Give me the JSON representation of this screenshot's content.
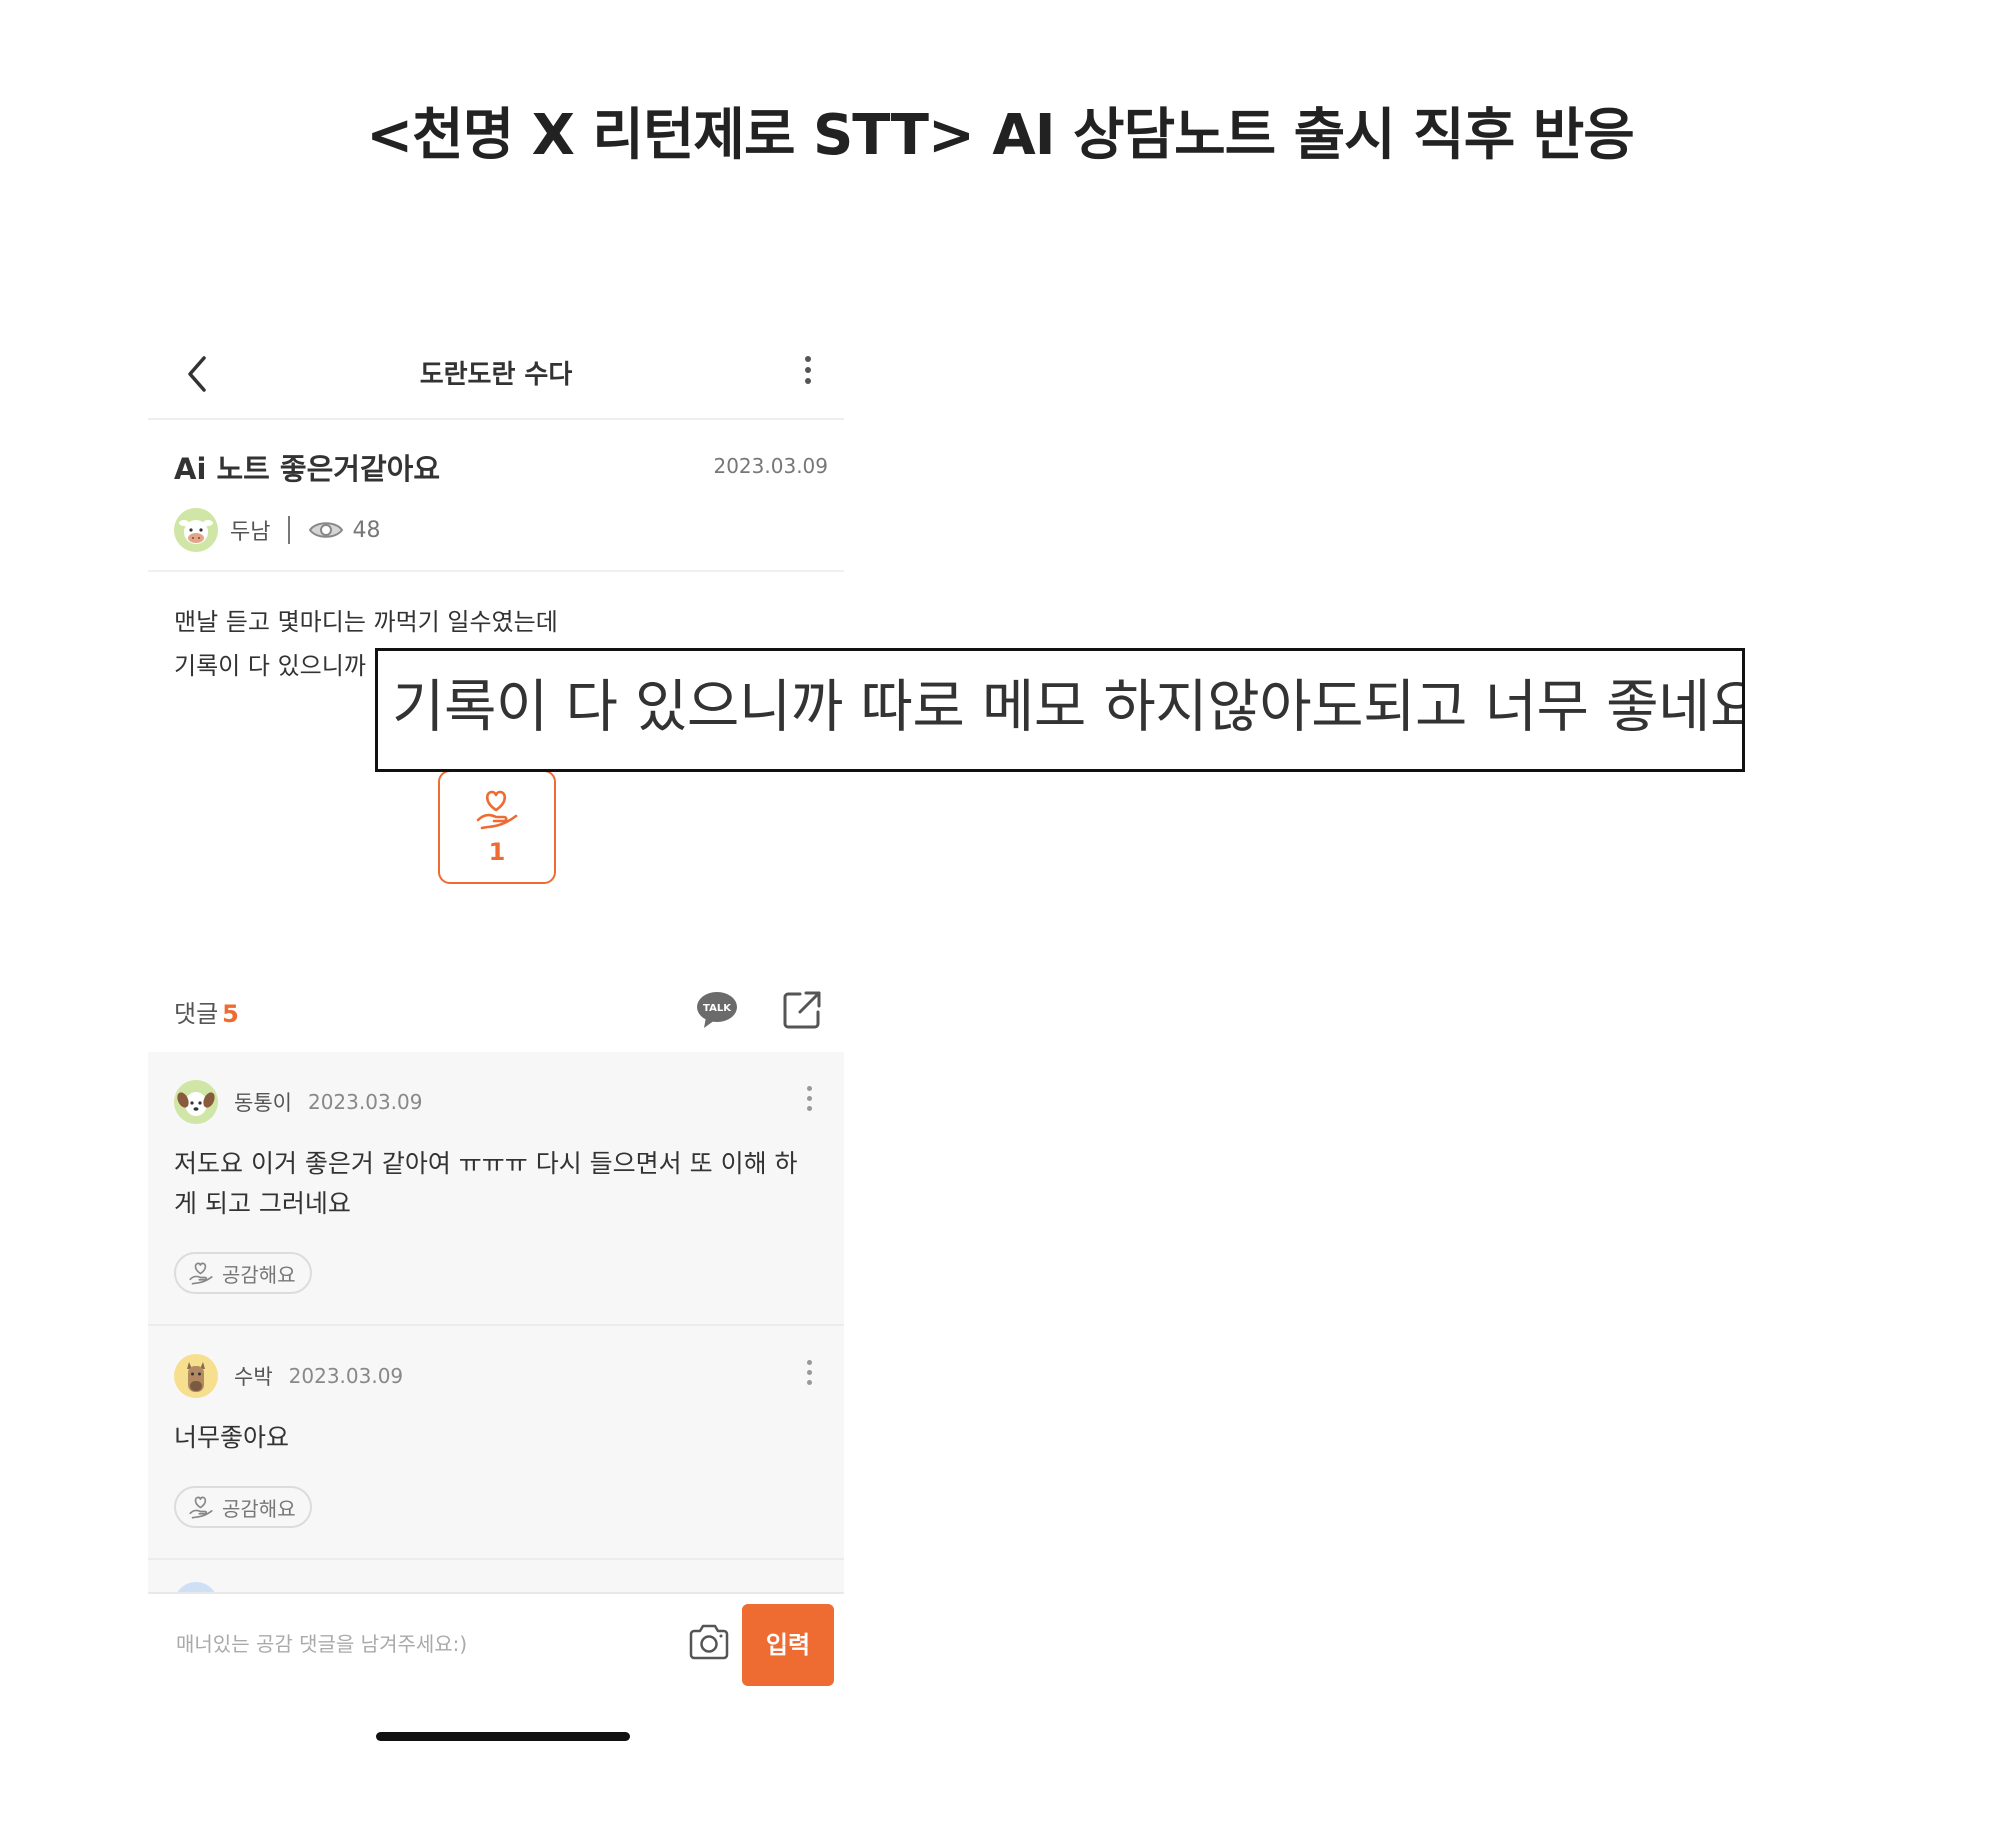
{
  "slide": {
    "title": "<천명 X 리턴제로 STT> AI  상담노트 출시 직후 반응"
  },
  "screen": {
    "board_title": "도란도란 수다",
    "post": {
      "title": "Ai 노트 좋은거같아요",
      "date": "2023.03.09",
      "author": "두남",
      "views": "48",
      "body_line1": "맨날 듣고 몇마디는 까먹기 일수였는데",
      "body_line2": "기록이 다 있으니까",
      "like_count": "1"
    },
    "callout_text": "기록이 다 있으니까 따로 메모 하지않아도되고 너무 좋네요",
    "comments": {
      "label": "댓글",
      "count": "5",
      "talk_icon_text": "TALK",
      "items": [
        {
          "author": "동통이",
          "date": "2023.03.09",
          "text": "저도요 이거 좋은거 같아여 ㅠㅠㅠ 다시 들으면서 또 이해 하게 되고 그러네요",
          "empathy_label": "공감해요"
        },
        {
          "author": "수박",
          "date": "2023.03.09",
          "text": "너무좋아요",
          "empathy_label": "공감해요"
        }
      ]
    },
    "input": {
      "placeholder": "매너있는 공감 댓글을 남겨주세요:)",
      "submit_label": "입력"
    }
  },
  "colors": {
    "accent": "#ee6b32",
    "comment_bg": "#f7f7f7",
    "text": "#333333"
  }
}
